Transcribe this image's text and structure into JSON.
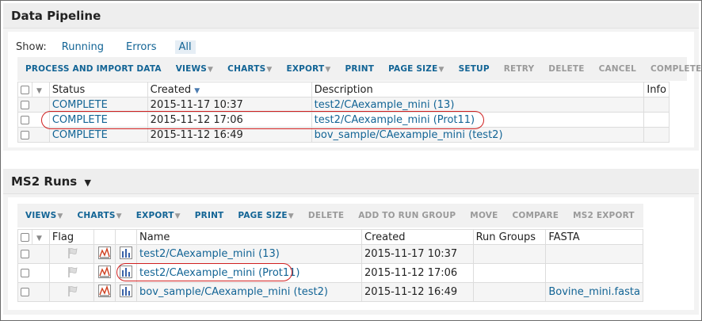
{
  "pipeline": {
    "title": "Data Pipeline",
    "show_label": "Show:",
    "show_options": [
      "Running",
      "Errors",
      "All"
    ],
    "toolbar": [
      {
        "label": "PROCESS AND IMPORT DATA",
        "dropdown": false,
        "enabled": true
      },
      {
        "label": "VIEWS",
        "dropdown": true,
        "enabled": true
      },
      {
        "label": "CHARTS",
        "dropdown": true,
        "enabled": true
      },
      {
        "label": "EXPORT",
        "dropdown": true,
        "enabled": true
      },
      {
        "label": "PRINT",
        "dropdown": false,
        "enabled": true
      },
      {
        "label": "PAGE SIZE",
        "dropdown": true,
        "enabled": true
      },
      {
        "label": "SETUP",
        "dropdown": false,
        "enabled": true
      },
      {
        "label": "RETRY",
        "dropdown": false,
        "enabled": false
      },
      {
        "label": "DELETE",
        "dropdown": false,
        "enabled": false
      },
      {
        "label": "CANCEL",
        "dropdown": false,
        "enabled": false
      },
      {
        "label": "COMPLETE",
        "dropdown": false,
        "enabled": false
      }
    ],
    "columns": {
      "status": "Status",
      "created": "Created",
      "description": "Description",
      "info": "Info"
    },
    "rows": [
      {
        "status": "COMPLETE",
        "created": "2015-11-17 10:37",
        "description": "test2/CAexample_mini (13)"
      },
      {
        "status": "COMPLETE",
        "created": "2015-11-12 17:06",
        "description": "test2/CAexample_mini (Prot11)"
      },
      {
        "status": "COMPLETE",
        "created": "2015-11-12 16:49",
        "description": "bov_sample/CAexample_mini (test2)"
      }
    ]
  },
  "ms2": {
    "title": "MS2 Runs",
    "toolbar": [
      {
        "label": "VIEWS",
        "dropdown": true,
        "enabled": true
      },
      {
        "label": "CHARTS",
        "dropdown": true,
        "enabled": true
      },
      {
        "label": "EXPORT",
        "dropdown": true,
        "enabled": true
      },
      {
        "label": "PRINT",
        "dropdown": false,
        "enabled": true
      },
      {
        "label": "PAGE SIZE",
        "dropdown": true,
        "enabled": true
      },
      {
        "label": "DELETE",
        "dropdown": false,
        "enabled": false
      },
      {
        "label": "ADD TO RUN GROUP",
        "dropdown": false,
        "enabled": false
      },
      {
        "label": "MOVE",
        "dropdown": false,
        "enabled": false
      },
      {
        "label": "COMPARE",
        "dropdown": false,
        "enabled": false
      },
      {
        "label": "MS2 EXPORT",
        "dropdown": false,
        "enabled": false
      }
    ],
    "columns": {
      "flag": "Flag",
      "name": "Name",
      "created": "Created",
      "run_groups": "Run Groups",
      "fasta": "FASTA"
    },
    "rows": [
      {
        "name": "test2/CAexample_mini (13)",
        "created": "2015-11-17 10:37",
        "run_groups": "",
        "fasta": ""
      },
      {
        "name": "test2/CAexample_mini (Prot11)",
        "created": "2015-11-12 17:06",
        "run_groups": "",
        "fasta": ""
      },
      {
        "name": "bov_sample/CAexample_mini (test2)",
        "created": "2015-11-12 16:49",
        "run_groups": "",
        "fasta": "Bovine_mini.fasta"
      }
    ]
  },
  "colors": {
    "link": "#126495",
    "highlight_oval": "#d02020",
    "disabled": "#9a9a9a"
  }
}
